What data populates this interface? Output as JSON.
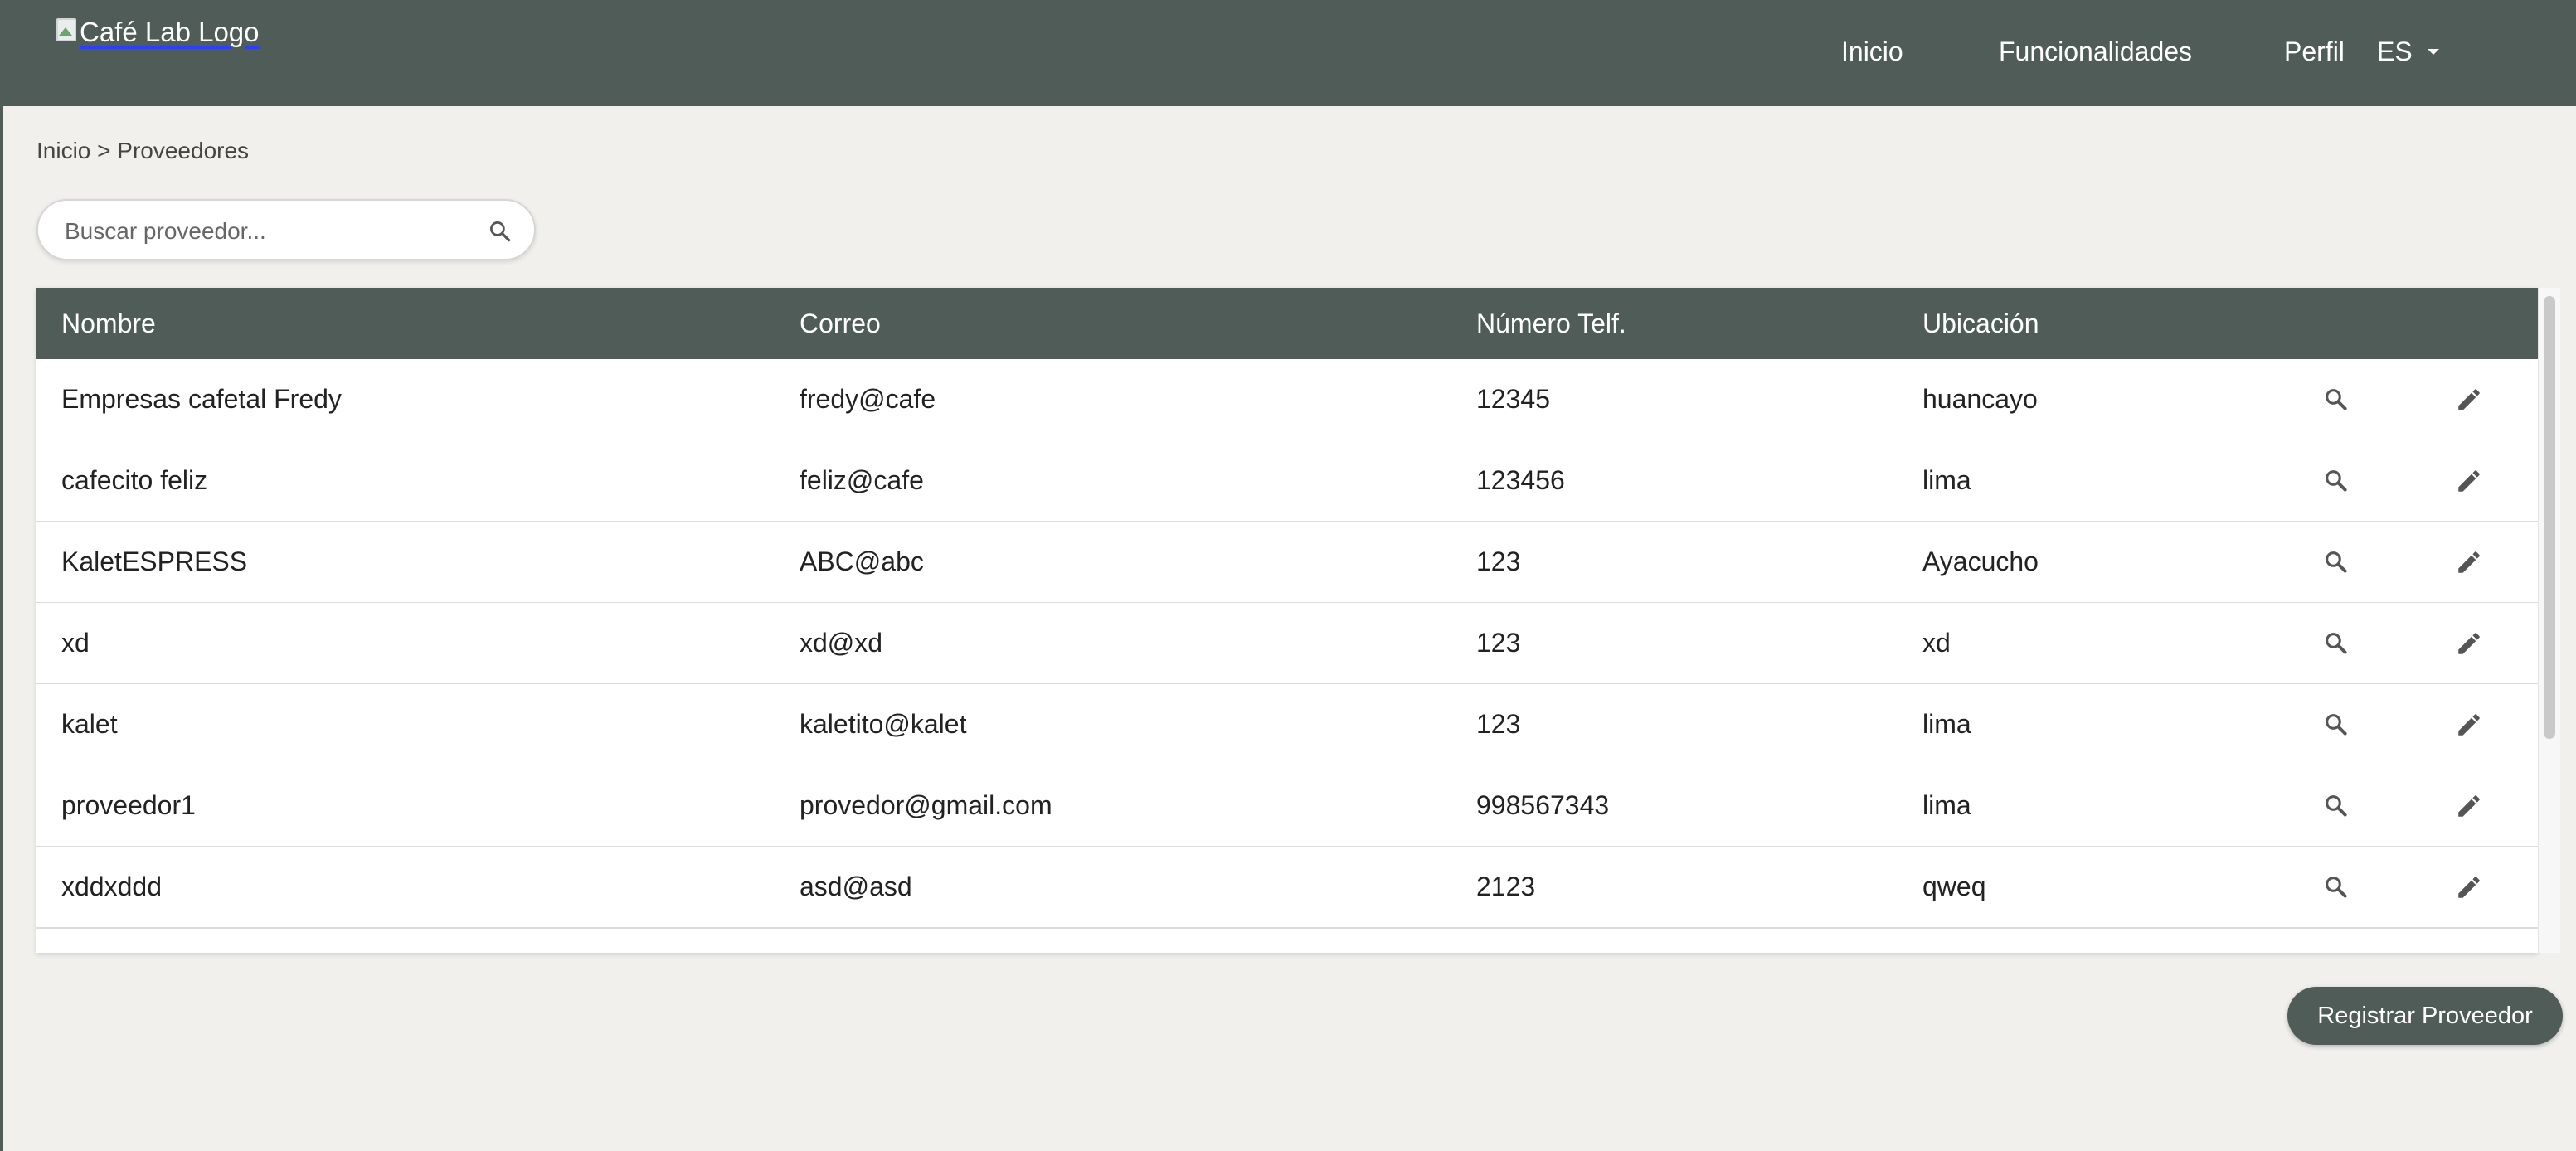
{
  "header": {
    "logo_alt": "Café Lab Logo",
    "nav": {
      "inicio": "Inicio",
      "funcionalidades": "Funcionalidades",
      "perfil": "Perfil",
      "language": "ES"
    }
  },
  "breadcrumb": "Inicio > Proveedores",
  "search": {
    "placeholder": "Buscar proveedor..."
  },
  "table": {
    "headers": [
      "Nombre",
      "Correo",
      "Número Telf.",
      "Ubicación"
    ],
    "rows": [
      {
        "nombre": "Empresas cafetal Fredy",
        "correo": "fredy@cafe",
        "telefono": "12345",
        "ubicacion": "huancayo"
      },
      {
        "nombre": "cafecito feliz",
        "correo": "feliz@cafe",
        "telefono": "123456",
        "ubicacion": "lima"
      },
      {
        "nombre": "KaletESPRESS",
        "correo": "ABC@abc",
        "telefono": "123",
        "ubicacion": "Ayacucho"
      },
      {
        "nombre": "xd",
        "correo": "xd@xd",
        "telefono": "123",
        "ubicacion": "xd"
      },
      {
        "nombre": "kalet",
        "correo": "kaletito@kalet",
        "telefono": "123",
        "ubicacion": "lima"
      },
      {
        "nombre": "proveedor1",
        "correo": "provedor@gmail.com",
        "telefono": "998567343",
        "ubicacion": "lima"
      },
      {
        "nombre": "xddxddd",
        "correo": "asd@asd",
        "telefono": "2123",
        "ubicacion": "qweq"
      }
    ]
  },
  "register_button": "Registrar Proveedor",
  "colors": {
    "primary": "#4f5c58",
    "background": "#f1f0ed"
  },
  "icons": {
    "search": "search-icon",
    "view": "magnifier-icon",
    "edit": "pencil-icon",
    "language_dropdown": "caret-down-icon"
  }
}
